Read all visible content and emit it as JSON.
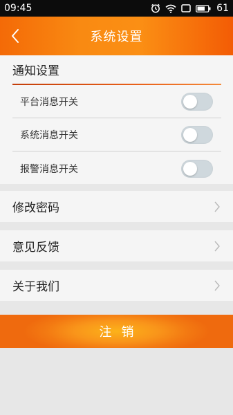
{
  "status_bar": {
    "time": "09:45",
    "battery": "61"
  },
  "header": {
    "title": "系统设置",
    "back_icon": "chevron-left-icon"
  },
  "notify": {
    "heading": "通知设置",
    "toggles": [
      {
        "label": "平台消息开关",
        "on": false
      },
      {
        "label": "系统消息开关",
        "on": false
      },
      {
        "label": "报警消息开关",
        "on": false
      }
    ]
  },
  "menu": [
    {
      "label": "修改密码",
      "icon": "chevron-right-icon"
    },
    {
      "label": "意见反馈",
      "icon": "chevron-right-icon"
    },
    {
      "label": "关于我们",
      "icon": "chevron-right-icon"
    }
  ],
  "logout": {
    "label": "注销"
  },
  "colors": {
    "accent": "#f7820f",
    "toggle_off": "#cfd8dd",
    "background": "#e7e7e7"
  }
}
